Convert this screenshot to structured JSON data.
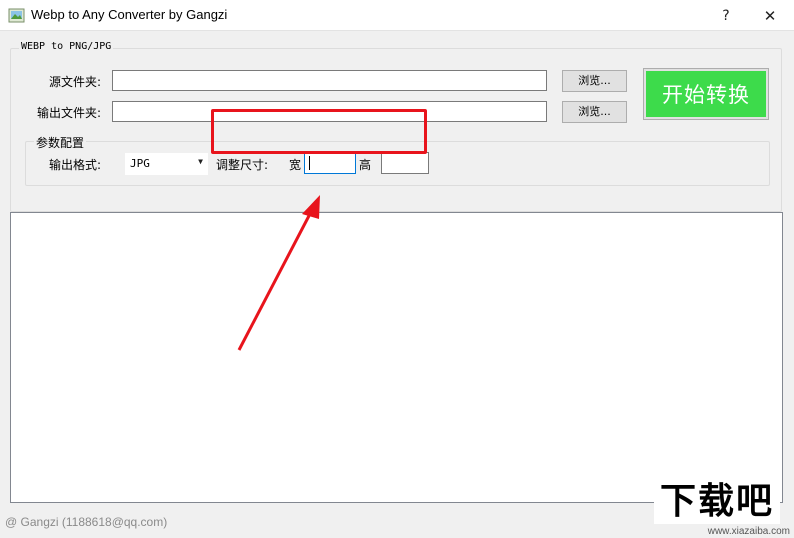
{
  "window": {
    "title": "Webp to Any Converter by Gangzi",
    "help_label": "?",
    "close_label": "✕",
    "icon": "image-app-icon"
  },
  "conversion_group": {
    "label": "WEBP to PNG/JPG",
    "source_folder_label": "源文件夹:",
    "source_folder_value": "",
    "output_folder_label": "输出文件夹:",
    "output_folder_value": "",
    "browse_label": "浏览...",
    "start_label": "开始转换",
    "start_color": "#3ddb4b"
  },
  "params_group": {
    "label": "参数配置",
    "format_label": "输出格式:",
    "format_value": "JPG",
    "resize_label": "调整尺寸:",
    "width_label": "宽",
    "width_value": "",
    "height_label": "高",
    "height_value": ""
  },
  "annotation": {
    "highlight_color": "#e8141c"
  },
  "status_bar": {
    "text": "@ Gangzi (1188618@qq.com)"
  },
  "watermark": {
    "logo_text": "下载吧",
    "url": "www.xiazaiba.com"
  }
}
